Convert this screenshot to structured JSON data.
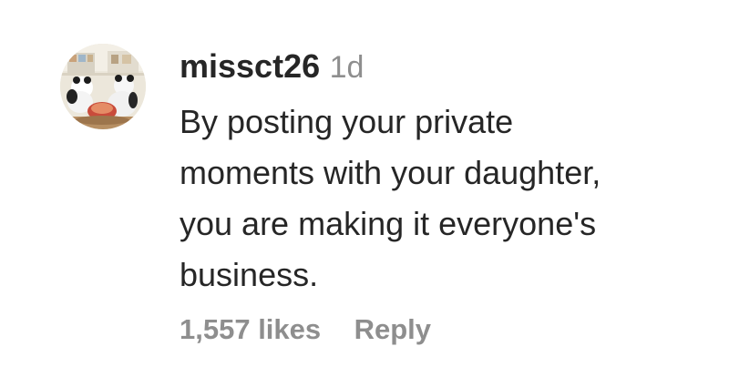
{
  "comment": {
    "username": "missct26",
    "timestamp": "1d",
    "text_lines": [
      "By posting your private",
      "moments with your daughter,",
      "you are making it everyone's",
      "business."
    ],
    "likes": "1,557 likes",
    "reply_label": "Reply",
    "avatar_icon": "profile-photo"
  },
  "colors": {
    "primary_text": "#262626",
    "secondary_text": "#8e8e8e",
    "background": "#ffffff"
  }
}
